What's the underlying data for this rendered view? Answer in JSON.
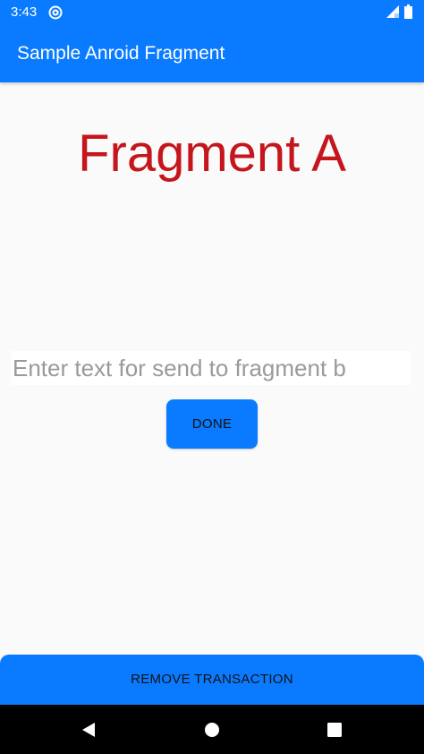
{
  "status_bar": {
    "time": "3:43",
    "icons": [
      "at-sign-icon",
      "signal-icon",
      "battery-icon"
    ]
  },
  "app_bar": {
    "title": "Sample Anroid Fragment"
  },
  "main": {
    "heading": "Fragment A",
    "input": {
      "value": "",
      "placeholder": "Enter text for send to fragment b"
    },
    "done_label": "DONE",
    "remove_label": "REMOVE TRANSACTION"
  },
  "nav_bar": {
    "icons": [
      "back-icon",
      "home-icon",
      "recents-icon"
    ]
  },
  "colors": {
    "accent": "#0a7bff",
    "heading": "#c4161c",
    "background": "#fafafa",
    "nav": "#000000"
  }
}
